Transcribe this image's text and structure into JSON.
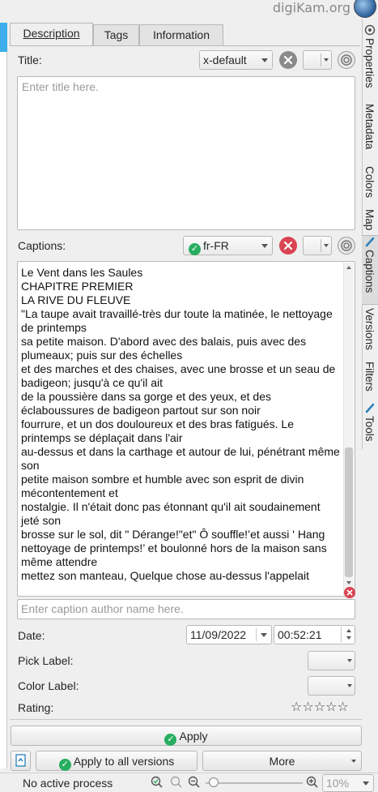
{
  "header": {
    "brand": "digiKam.org"
  },
  "tabs": [
    {
      "label": "Description",
      "active": true
    },
    {
      "label": "Tags",
      "active": false
    },
    {
      "label": "Information",
      "active": false
    }
  ],
  "title_section": {
    "label": "Title:",
    "language": "x-default",
    "placeholder": "Enter title here."
  },
  "captions_section": {
    "label": "Captions:",
    "language": "fr-FR",
    "text": "Le Vent dans les Saules\nCHAPITRE PREMIER\nLA RIVE DU FLEUVE\n\"La taupe avait travaillé-très dur toute la matinée, le nettoyage de printemps\nsa petite maison. D'abord avec des balais, puis avec des plumeaux; puis sur des échelles\net des marches et des chaises, avec une brosse et un seau de badigeon; jusqu'à ce qu'il ait\nde la poussière dans sa gorge et des yeux, et des éclaboussures de badigeon partout sur son noir\nfourrure, et un dos douloureux et des bras fatigués. Le printemps se déplaçait dans l'air\nau-dessus et dans la carthage et autour de lui, pénétrant même son\npetite maison sombre et humble avec son esprit de divin mécontentement et\nnostalgie. Il n'était donc pas étonnant qu'il ait soudainement jeté son\nbrosse sur le sol, dit \" Dérange!\"et\" Ô souffle!’et aussi ' Hang\nnettoyage de printemps!’ et boulonné hors de la maison sans même attendre\nmettez son manteau, Quelque chose au-dessus l'appelait",
    "author_placeholder": "Enter caption author name here."
  },
  "date_section": {
    "label": "Date:",
    "date": "11/09/2022",
    "time": "00:52:21"
  },
  "pick_label": {
    "label": "Pick Label:"
  },
  "color_label": {
    "label": "Color Label:"
  },
  "rating": {
    "label": "Rating:",
    "stars": "☆☆☆☆☆",
    "value": 0
  },
  "buttons": {
    "apply": "Apply",
    "apply_all": "Apply to all versions",
    "more": "More"
  },
  "sidebar_tabs": [
    {
      "label": "Properties"
    },
    {
      "label": "Metadata"
    },
    {
      "label": "Colors"
    },
    {
      "label": "Map"
    },
    {
      "label": "Captions",
      "active": true
    },
    {
      "label": "Versions"
    },
    {
      "label": "Filters"
    },
    {
      "label": "Tools"
    }
  ],
  "status": {
    "process": "No active process",
    "zoom": "10%"
  },
  "colors": {
    "accent": "#3daee9",
    "ok_green": "#27ae60",
    "error_red": "#da4453"
  }
}
